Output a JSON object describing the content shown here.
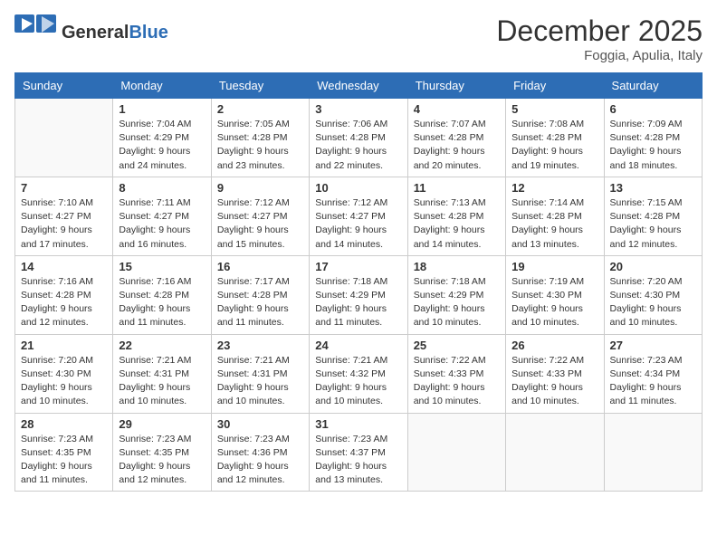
{
  "header": {
    "logo_general": "General",
    "logo_blue": "Blue",
    "month_title": "December 2025",
    "location": "Foggia, Apulia, Italy"
  },
  "weekdays": [
    "Sunday",
    "Monday",
    "Tuesday",
    "Wednesday",
    "Thursday",
    "Friday",
    "Saturday"
  ],
  "weeks": [
    [
      {
        "day": "",
        "sunrise": "",
        "sunset": "",
        "daylight": ""
      },
      {
        "day": "1",
        "sunrise": "Sunrise: 7:04 AM",
        "sunset": "Sunset: 4:29 PM",
        "daylight": "Daylight: 9 hours and 24 minutes."
      },
      {
        "day": "2",
        "sunrise": "Sunrise: 7:05 AM",
        "sunset": "Sunset: 4:28 PM",
        "daylight": "Daylight: 9 hours and 23 minutes."
      },
      {
        "day": "3",
        "sunrise": "Sunrise: 7:06 AM",
        "sunset": "Sunset: 4:28 PM",
        "daylight": "Daylight: 9 hours and 22 minutes."
      },
      {
        "day": "4",
        "sunrise": "Sunrise: 7:07 AM",
        "sunset": "Sunset: 4:28 PM",
        "daylight": "Daylight: 9 hours and 20 minutes."
      },
      {
        "day": "5",
        "sunrise": "Sunrise: 7:08 AM",
        "sunset": "Sunset: 4:28 PM",
        "daylight": "Daylight: 9 hours and 19 minutes."
      },
      {
        "day": "6",
        "sunrise": "Sunrise: 7:09 AM",
        "sunset": "Sunset: 4:28 PM",
        "daylight": "Daylight: 9 hours and 18 minutes."
      }
    ],
    [
      {
        "day": "7",
        "sunrise": "Sunrise: 7:10 AM",
        "sunset": "Sunset: 4:27 PM",
        "daylight": "Daylight: 9 hours and 17 minutes."
      },
      {
        "day": "8",
        "sunrise": "Sunrise: 7:11 AM",
        "sunset": "Sunset: 4:27 PM",
        "daylight": "Daylight: 9 hours and 16 minutes."
      },
      {
        "day": "9",
        "sunrise": "Sunrise: 7:12 AM",
        "sunset": "Sunset: 4:27 PM",
        "daylight": "Daylight: 9 hours and 15 minutes."
      },
      {
        "day": "10",
        "sunrise": "Sunrise: 7:12 AM",
        "sunset": "Sunset: 4:27 PM",
        "daylight": "Daylight: 9 hours and 14 minutes."
      },
      {
        "day": "11",
        "sunrise": "Sunrise: 7:13 AM",
        "sunset": "Sunset: 4:28 PM",
        "daylight": "Daylight: 9 hours and 14 minutes."
      },
      {
        "day": "12",
        "sunrise": "Sunrise: 7:14 AM",
        "sunset": "Sunset: 4:28 PM",
        "daylight": "Daylight: 9 hours and 13 minutes."
      },
      {
        "day": "13",
        "sunrise": "Sunrise: 7:15 AM",
        "sunset": "Sunset: 4:28 PM",
        "daylight": "Daylight: 9 hours and 12 minutes."
      }
    ],
    [
      {
        "day": "14",
        "sunrise": "Sunrise: 7:16 AM",
        "sunset": "Sunset: 4:28 PM",
        "daylight": "Daylight: 9 hours and 12 minutes."
      },
      {
        "day": "15",
        "sunrise": "Sunrise: 7:16 AM",
        "sunset": "Sunset: 4:28 PM",
        "daylight": "Daylight: 9 hours and 11 minutes."
      },
      {
        "day": "16",
        "sunrise": "Sunrise: 7:17 AM",
        "sunset": "Sunset: 4:28 PM",
        "daylight": "Daylight: 9 hours and 11 minutes."
      },
      {
        "day": "17",
        "sunrise": "Sunrise: 7:18 AM",
        "sunset": "Sunset: 4:29 PM",
        "daylight": "Daylight: 9 hours and 11 minutes."
      },
      {
        "day": "18",
        "sunrise": "Sunrise: 7:18 AM",
        "sunset": "Sunset: 4:29 PM",
        "daylight": "Daylight: 9 hours and 10 minutes."
      },
      {
        "day": "19",
        "sunrise": "Sunrise: 7:19 AM",
        "sunset": "Sunset: 4:30 PM",
        "daylight": "Daylight: 9 hours and 10 minutes."
      },
      {
        "day": "20",
        "sunrise": "Sunrise: 7:20 AM",
        "sunset": "Sunset: 4:30 PM",
        "daylight": "Daylight: 9 hours and 10 minutes."
      }
    ],
    [
      {
        "day": "21",
        "sunrise": "Sunrise: 7:20 AM",
        "sunset": "Sunset: 4:30 PM",
        "daylight": "Daylight: 9 hours and 10 minutes."
      },
      {
        "day": "22",
        "sunrise": "Sunrise: 7:21 AM",
        "sunset": "Sunset: 4:31 PM",
        "daylight": "Daylight: 9 hours and 10 minutes."
      },
      {
        "day": "23",
        "sunrise": "Sunrise: 7:21 AM",
        "sunset": "Sunset: 4:31 PM",
        "daylight": "Daylight: 9 hours and 10 minutes."
      },
      {
        "day": "24",
        "sunrise": "Sunrise: 7:21 AM",
        "sunset": "Sunset: 4:32 PM",
        "daylight": "Daylight: 9 hours and 10 minutes."
      },
      {
        "day": "25",
        "sunrise": "Sunrise: 7:22 AM",
        "sunset": "Sunset: 4:33 PM",
        "daylight": "Daylight: 9 hours and 10 minutes."
      },
      {
        "day": "26",
        "sunrise": "Sunrise: 7:22 AM",
        "sunset": "Sunset: 4:33 PM",
        "daylight": "Daylight: 9 hours and 10 minutes."
      },
      {
        "day": "27",
        "sunrise": "Sunrise: 7:23 AM",
        "sunset": "Sunset: 4:34 PM",
        "daylight": "Daylight: 9 hours and 11 minutes."
      }
    ],
    [
      {
        "day": "28",
        "sunrise": "Sunrise: 7:23 AM",
        "sunset": "Sunset: 4:35 PM",
        "daylight": "Daylight: 9 hours and 11 minutes."
      },
      {
        "day": "29",
        "sunrise": "Sunrise: 7:23 AM",
        "sunset": "Sunset: 4:35 PM",
        "daylight": "Daylight: 9 hours and 12 minutes."
      },
      {
        "day": "30",
        "sunrise": "Sunrise: 7:23 AM",
        "sunset": "Sunset: 4:36 PM",
        "daylight": "Daylight: 9 hours and 12 minutes."
      },
      {
        "day": "31",
        "sunrise": "Sunrise: 7:23 AM",
        "sunset": "Sunset: 4:37 PM",
        "daylight": "Daylight: 9 hours and 13 minutes."
      },
      {
        "day": "",
        "sunrise": "",
        "sunset": "",
        "daylight": ""
      },
      {
        "day": "",
        "sunrise": "",
        "sunset": "",
        "daylight": ""
      },
      {
        "day": "",
        "sunrise": "",
        "sunset": "",
        "daylight": ""
      }
    ]
  ]
}
